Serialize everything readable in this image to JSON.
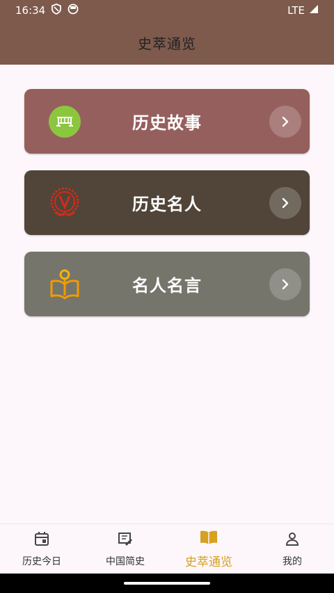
{
  "status_bar": {
    "time": "16:34",
    "network": "LTE"
  },
  "app_bar": {
    "title": "史萃通览"
  },
  "cards": [
    {
      "label": "历史故事",
      "icon": "bridge-icon",
      "color": "#955f5d"
    },
    {
      "label": "历史名人",
      "icon": "v-badge-icon",
      "color": "#504538"
    },
    {
      "label": "名人名言",
      "icon": "reading-person-icon",
      "color": "#76756b"
    }
  ],
  "bottom_nav": [
    {
      "label": "历史今日",
      "icon": "calendar-icon",
      "active": false
    },
    {
      "label": "中国简史",
      "icon": "scroll-icon",
      "active": false
    },
    {
      "label": "史萃通览",
      "icon": "book-icon",
      "active": true
    },
    {
      "label": "我的",
      "icon": "person-icon",
      "active": false
    }
  ],
  "colors": {
    "accent": "#d6a020",
    "app_bar": "#7d5a4c",
    "background": "#fdf7fb"
  }
}
